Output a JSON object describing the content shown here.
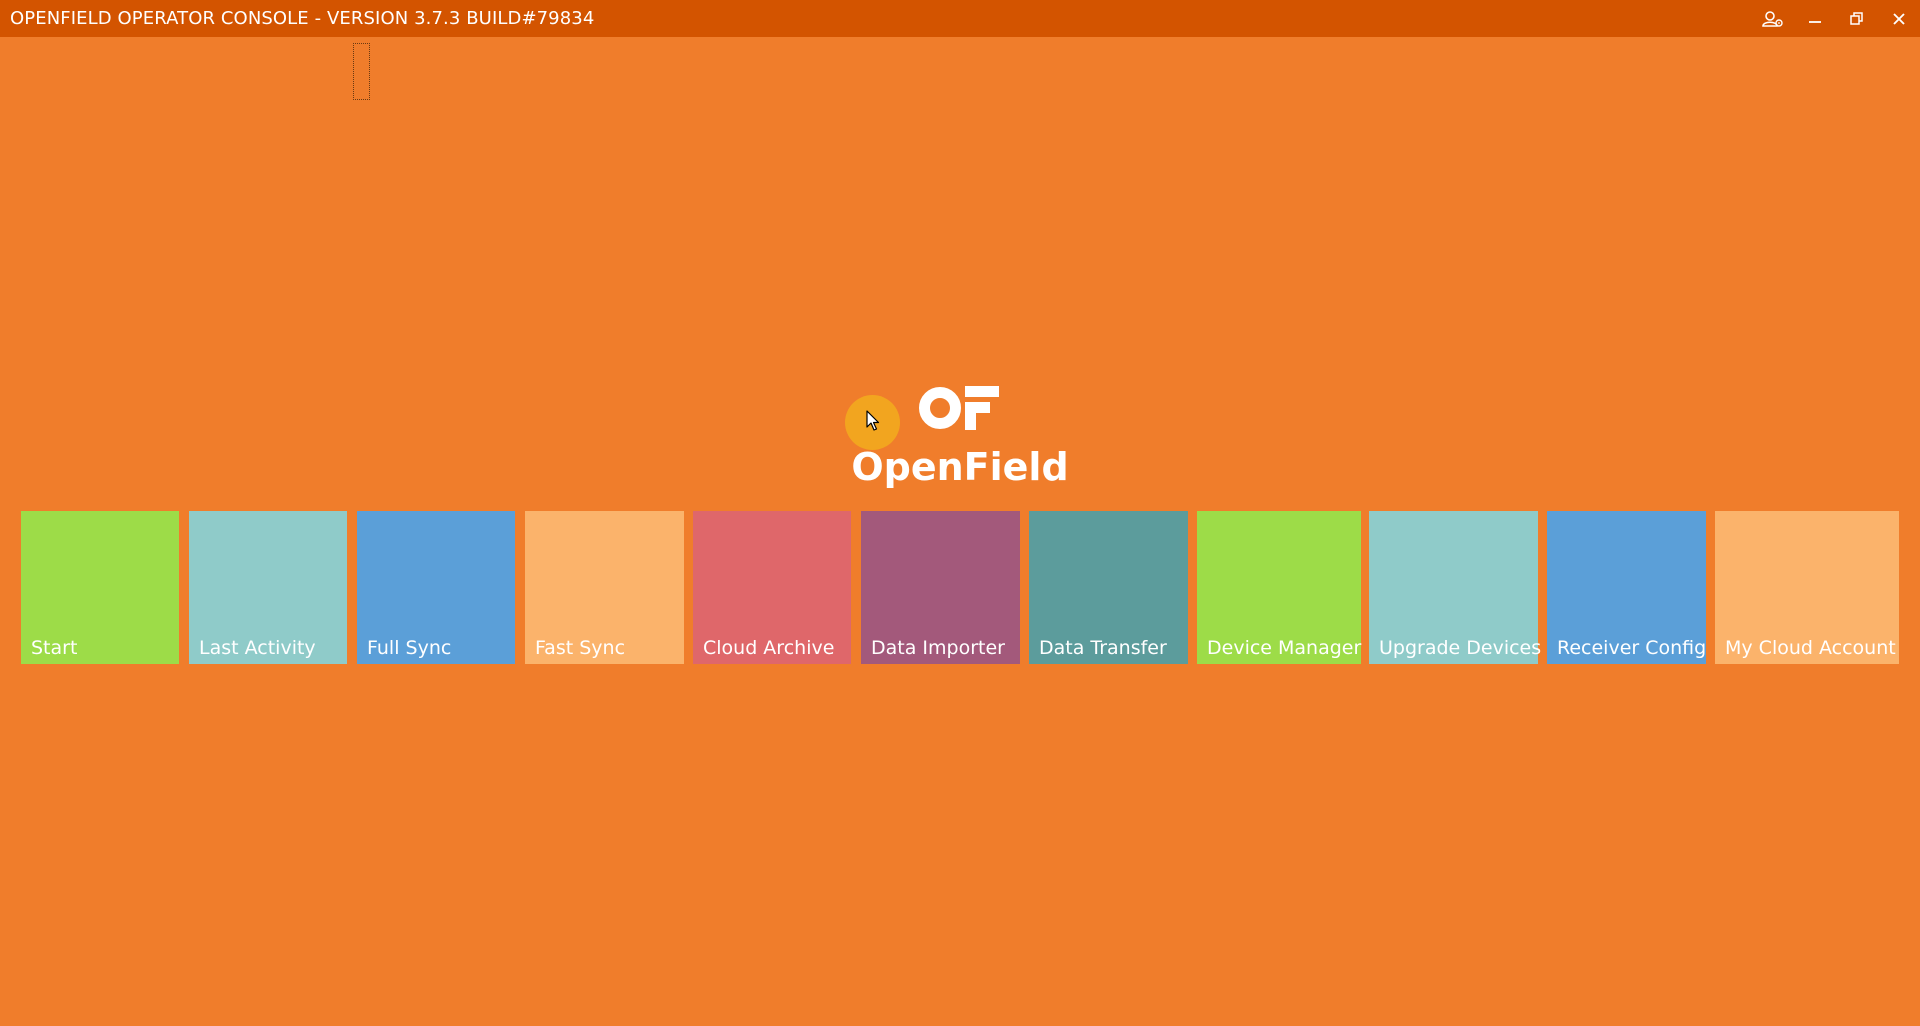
{
  "window": {
    "title": "OPENFIELD OPERATOR CONSOLE - VERSION 3.7.3 BUILD#79834",
    "controls": [
      {
        "name": "user-settings-icon"
      },
      {
        "name": "minimize-icon"
      },
      {
        "name": "restore-icon"
      },
      {
        "name": "close-icon"
      }
    ]
  },
  "brand": {
    "logo_icon": "openfield-logo",
    "app_name": "OpenField"
  },
  "tiles": [
    {
      "label": "Start",
      "color": "#9ddc48"
    },
    {
      "label": "Last Activity",
      "color": "#8fcbc9"
    },
    {
      "label": "Full Sync",
      "color": "#5b9fd8"
    },
    {
      "label": "Fast Sync",
      "color": "#fbb36b"
    },
    {
      "label": "Cloud Archive",
      "color": "#df676a"
    },
    {
      "label": "Data Importer",
      "color": "#a3597b"
    },
    {
      "label": "Data Transfer",
      "color": "#5c9c9c"
    },
    {
      "label": "Device Manager",
      "color": "#9ddc48"
    },
    {
      "label": "Upgrade Devices",
      "color": "#8fcbc9"
    },
    {
      "label": "Receiver Config",
      "color": "#5b9fd8"
    },
    {
      "label": "My Cloud Account",
      "color": "#fbb36b"
    }
  ],
  "colors": {
    "background": "#f07d2b",
    "titlebar": "#d35400",
    "cursor_highlight": "#f2a51f"
  }
}
